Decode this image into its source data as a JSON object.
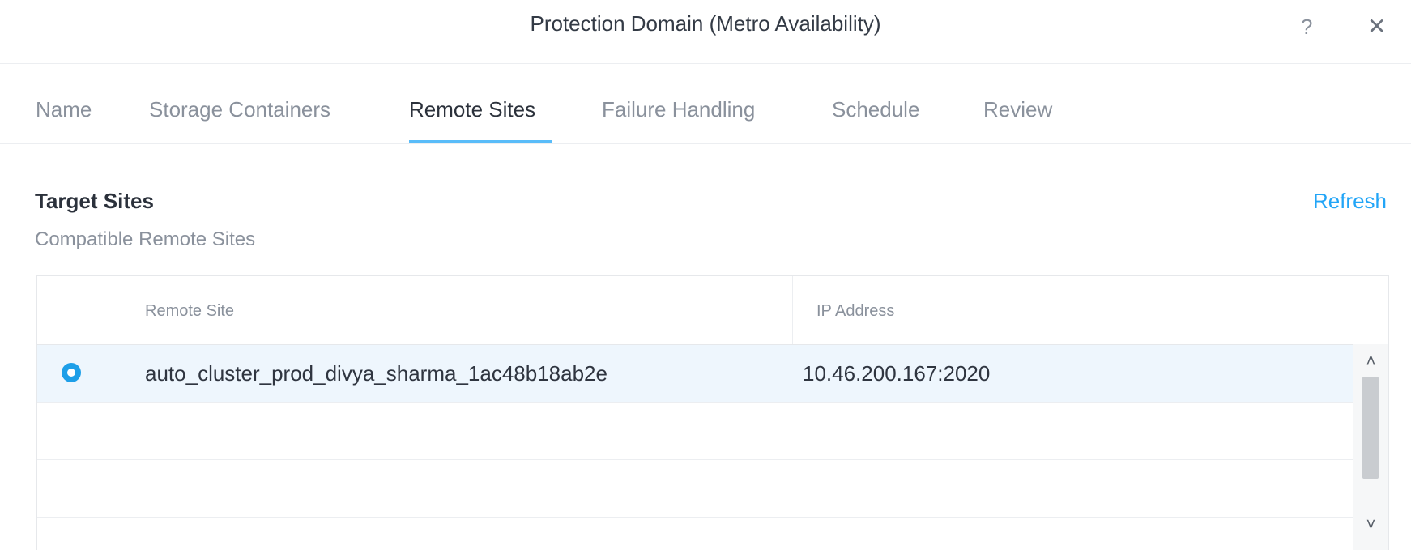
{
  "dialog": {
    "title": "Protection Domain (Metro Availability)",
    "help_icon": "?",
    "close_icon": "✕"
  },
  "tabs": [
    {
      "label": "Name",
      "active": false
    },
    {
      "label": "Storage Containers",
      "active": false
    },
    {
      "label": "Remote Sites",
      "active": true
    },
    {
      "label": "Failure Handling",
      "active": false
    },
    {
      "label": "Schedule",
      "active": false
    },
    {
      "label": "Review",
      "active": false
    }
  ],
  "section": {
    "title": "Target Sites",
    "subtitle": "Compatible Remote Sites",
    "refresh_label": "Refresh"
  },
  "table": {
    "columns": [
      "Remote Site",
      "IP Address"
    ],
    "rows": [
      {
        "remote_site": "auto_cluster_prod_divya_sharma_1ac48b18ab2e",
        "ip_address": "10.46.200.167:2020",
        "selected": true
      }
    ]
  },
  "scrollbar": {
    "up_icon": "˄",
    "down_icon": "˅"
  },
  "colors": {
    "accent": "#22a5f7",
    "selected_row": "#eef6fd",
    "radio": "#1e9fe8"
  }
}
